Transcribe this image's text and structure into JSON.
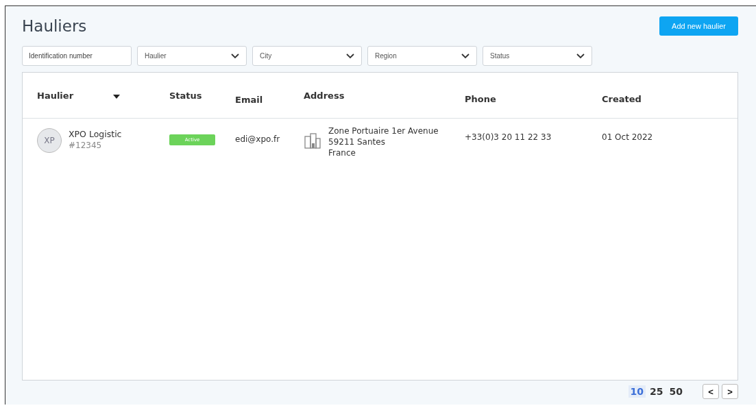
{
  "title": "Hauliers",
  "add_button": "Add new haulier",
  "filters": [
    {
      "kind": "input",
      "placeholder": "Identification number"
    },
    {
      "kind": "select",
      "label": "Haulier"
    },
    {
      "kind": "select",
      "label": "City"
    },
    {
      "kind": "select",
      "label": "Region"
    },
    {
      "kind": "select",
      "label": "Status"
    }
  ],
  "table": {
    "columns": [
      {
        "label": "Haulier",
        "sorted": true
      },
      {
        "label": "Status",
        "sorted": false
      },
      {
        "label": "Email",
        "sorted": false
      },
      {
        "label": "Address",
        "sorted": false
      },
      {
        "label": "Phone",
        "sorted": false
      },
      {
        "label": "Created",
        "sorted": false
      }
    ],
    "rows": [
      {
        "initials": "XP",
        "name": "XPO Logistic",
        "id": "#12345",
        "status": "Active",
        "color": "#6cd35a",
        "email": "edi@xpo.fr",
        "address": [
          "Zone Portuaire 1er Avenue",
          "59211 Santes",
          "France"
        ],
        "phone": "+33(0)3 20 11 22 33",
        "created": "01 Oct 2022"
      }
    ]
  },
  "page_sizes": [
    {
      "label": "10",
      "selected": true
    },
    {
      "label": "25",
      "selected": false
    },
    {
      "label": "50",
      "selected": false
    }
  ],
  "pager": [
    "<",
    ">"
  ]
}
